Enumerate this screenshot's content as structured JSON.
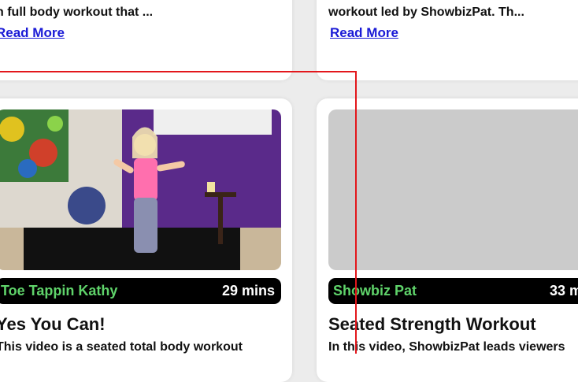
{
  "cards_top": [
    {
      "desc_line": "n full body workout that ...",
      "read_more": "Read More"
    },
    {
      "desc_line": "workout led by ShowbizPat. Th...",
      "read_more": "Read More"
    }
  ],
  "cards_bottom": [
    {
      "instructor": "Toe Tappin Kathy",
      "duration": "29 mins",
      "title": "Yes You Can!",
      "desc_line": "This video is a seated total body workout"
    },
    {
      "instructor": "Showbiz Pat",
      "duration": "33 m",
      "title": "Seated Strength Workout",
      "desc_line": "In this video, ShowbizPat leads viewers"
    }
  ],
  "colors": {
    "instructor_green": "#5fd36a",
    "link_blue": "#1a1ad6",
    "overlay_red": "#e3171c",
    "placeholder_gray": "#cbcbcb"
  }
}
